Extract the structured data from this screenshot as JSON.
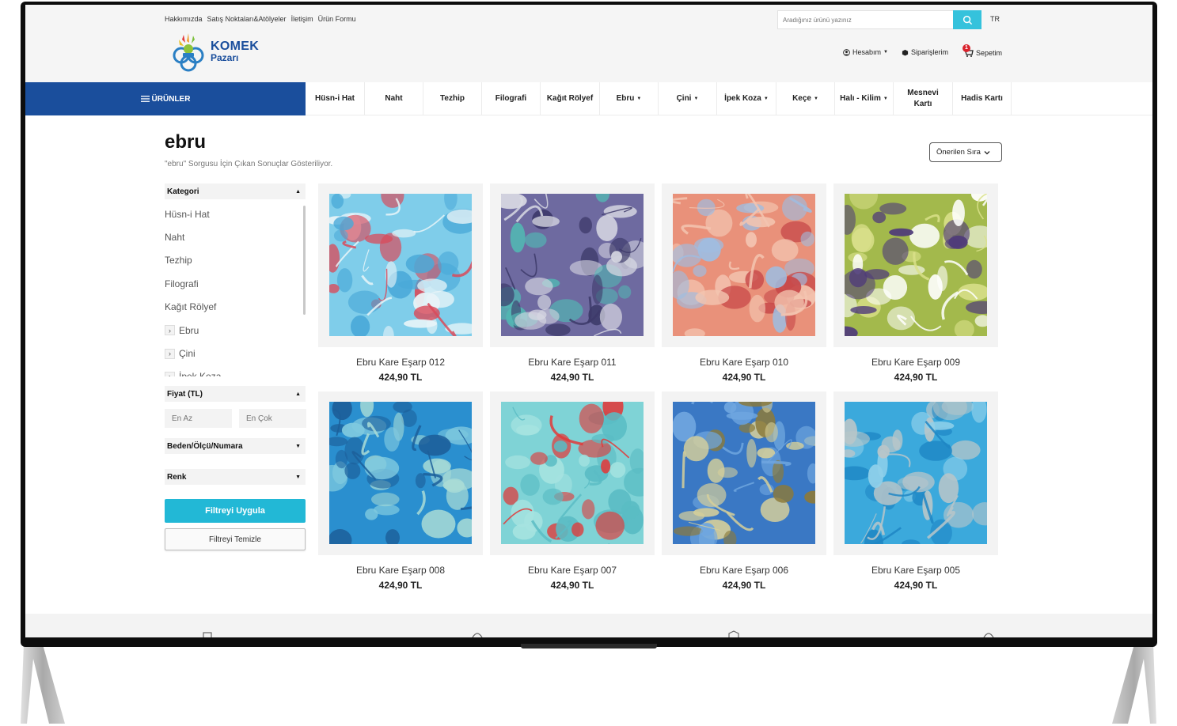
{
  "header": {
    "top_links": [
      "Hakkımızda",
      "Satış Noktaları&Atölyeler",
      "İletişim",
      "Ürün Formu"
    ],
    "search_placeholder": "Aradığınız ürünü yazınız",
    "language": "TR",
    "logo_line1": "KOMEK",
    "logo_line2": "Pazarı",
    "account_label": "Hesabım",
    "orders_label": "Siparişlerim",
    "cart_label": "Sepetim",
    "cart_count": "1"
  },
  "nav": {
    "products_label": "ÜRÜNLER",
    "items": [
      {
        "label": "Hüsn-i Hat",
        "dropdown": false
      },
      {
        "label": "Naht",
        "dropdown": false
      },
      {
        "label": "Tezhip",
        "dropdown": false
      },
      {
        "label": "Filografi",
        "dropdown": false
      },
      {
        "label": "Kağıt Rölyef",
        "dropdown": false
      },
      {
        "label": "Ebru",
        "dropdown": true
      },
      {
        "label": "Çini",
        "dropdown": true
      },
      {
        "label": "İpek Koza",
        "dropdown": true
      },
      {
        "label": "Keçe",
        "dropdown": true
      },
      {
        "label": "Halı - Kilim",
        "dropdown": true
      },
      {
        "label": "Mesnevi Kartı",
        "dropdown": false
      },
      {
        "label": "Hadis Kartı",
        "dropdown": false
      }
    ]
  },
  "page": {
    "title": "ebru",
    "subtitle": "\"ebru\" Sorgusu İçin Çıkan Sonuçlar Gösteriliyor.",
    "sort_label": "Önerilen Sıra"
  },
  "filters": {
    "category_heading": "Kategori",
    "categories": [
      {
        "label": "Hüsn-i Hat",
        "expandable": false
      },
      {
        "label": "Naht",
        "expandable": false
      },
      {
        "label": "Tezhip",
        "expandable": false
      },
      {
        "label": "Filografi",
        "expandable": false
      },
      {
        "label": "Kağıt Rölyef",
        "expandable": false
      },
      {
        "label": "Ebru",
        "expandable": true
      },
      {
        "label": "Çini",
        "expandable": true
      },
      {
        "label": "İpek Koza",
        "expandable": true
      }
    ],
    "price_heading": "Fiyat (TL)",
    "price_min_placeholder": "En Az",
    "price_max_placeholder": "En Çok",
    "size_heading": "Beden/Ölçü/Numara",
    "color_heading": "Renk",
    "apply_label": "Filtreyi Uygula",
    "clear_label": "Filtreyi Temizle"
  },
  "products": [
    {
      "name": "Ebru Kare Eşarp 012",
      "price": "424,90 TL",
      "palette": [
        "#7fcdea",
        "#4aa9d8",
        "#e8f4f8",
        "#d94a5a"
      ]
    },
    {
      "name": "Ebru Kare Eşarp 011",
      "price": "424,90 TL",
      "palette": [
        "#6e6aa0",
        "#52b7b3",
        "#d8d9e3",
        "#3d3a6a"
      ]
    },
    {
      "name": "Ebru Kare Eşarp 010",
      "price": "424,90 TL",
      "palette": [
        "#e9917a",
        "#c84a4a",
        "#9fbce0",
        "#f3c4b0"
      ]
    },
    {
      "name": "Ebru Kare Eşarp 009",
      "price": "424,90 TL",
      "palette": [
        "#a3b94c",
        "#4f3b7a",
        "#d9e08a",
        "#ffffff"
      ]
    },
    {
      "name": "Ebru Kare Eşarp 008",
      "price": "424,90 TL",
      "palette": [
        "#2a8fcf",
        "#7fc9df",
        "#1c5f9a",
        "#a9dcd6"
      ]
    },
    {
      "name": "Ebru Kare Eşarp 007",
      "price": "424,90 TL",
      "palette": [
        "#7fd3d6",
        "#a6e3e0",
        "#e03a3a",
        "#5abcc4"
      ]
    },
    {
      "name": "Ebru Kare Eşarp 006",
      "price": "424,90 TL",
      "palette": [
        "#3a78c4",
        "#8c7a3a",
        "#6fa6df",
        "#d6cf9a"
      ]
    },
    {
      "name": "Ebru Kare Eşarp 005",
      "price": "424,90 TL",
      "palette": [
        "#3ba9dc",
        "#8fd0ea",
        "#b9c6c9",
        "#1e86c4"
      ]
    }
  ]
}
